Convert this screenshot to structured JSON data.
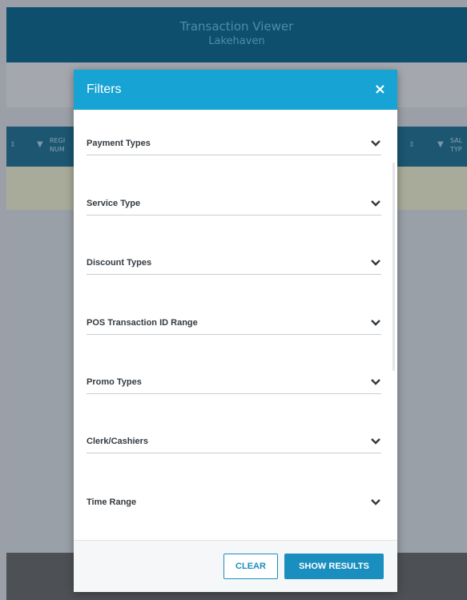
{
  "app": {
    "title": "Transaction Viewer",
    "subtitle": "Lakehaven",
    "columns": [
      "REGI\nNUM",
      "SAL\nTYP"
    ]
  },
  "modal": {
    "title": "Filters",
    "close_glyph": "×",
    "sections": [
      {
        "label": "Payment Types",
        "icon": "chevron-down-icon"
      },
      {
        "label": "Service Type",
        "icon": "chevron-down-icon"
      },
      {
        "label": "Discount Types",
        "icon": "chevron-down-icon"
      },
      {
        "label": "POS Transaction ID Range",
        "icon": "chevron-down-icon"
      },
      {
        "label": "Promo Types",
        "icon": "chevron-down-icon"
      },
      {
        "label": "Clerk/Cashiers",
        "icon": "chevron-down-icon"
      },
      {
        "label": "Time Range",
        "icon": "chevron-down-icon"
      }
    ],
    "footer": {
      "clear_label": "CLEAR",
      "show_results_label": "SHOW RESULTS"
    }
  },
  "colors": {
    "accent": "#17a3d3",
    "button": "#1a8fbf",
    "header_bg": "#0e4f6e"
  }
}
